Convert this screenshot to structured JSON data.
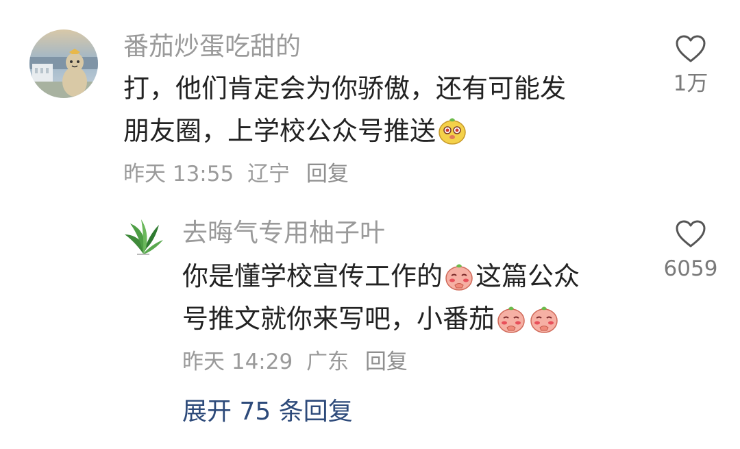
{
  "comments": [
    {
      "username": "番茄炒蛋吃甜的",
      "content_line1": "打，他们肯定会为你骄傲，还有可能发",
      "content_line2": "朋友圈，上学校公众号推送",
      "time": "昨天 13:55",
      "location": "辽宁",
      "reply_label": "回复",
      "likes": "1万",
      "avatar_icon": "peanut-doll-avatar",
      "emoji_icons": [
        "tomato-face-emoji"
      ]
    }
  ],
  "replies": [
    {
      "username": "去晦气专用柚子叶",
      "content_line1_a": "你是懂学校宣传工作的",
      "content_line1_b": "这篇公众",
      "content_line2": "号推文就你来写吧，小番茄",
      "time": "昨天 14:29",
      "location": "广东",
      "reply_label": "回复",
      "likes": "6059",
      "avatar_icon": "pomelo-leaf-avatar",
      "emoji_icons": [
        "shy-tomato-emoji",
        "shy-tomato-emoji",
        "shy-tomato-emoji"
      ]
    }
  ],
  "expand_replies": {
    "prefix": "展开",
    "count": "75",
    "suffix": "条回复"
  },
  "colors": {
    "username": "#9a9a9a",
    "content": "#222222",
    "link": "#2d4a7a"
  }
}
